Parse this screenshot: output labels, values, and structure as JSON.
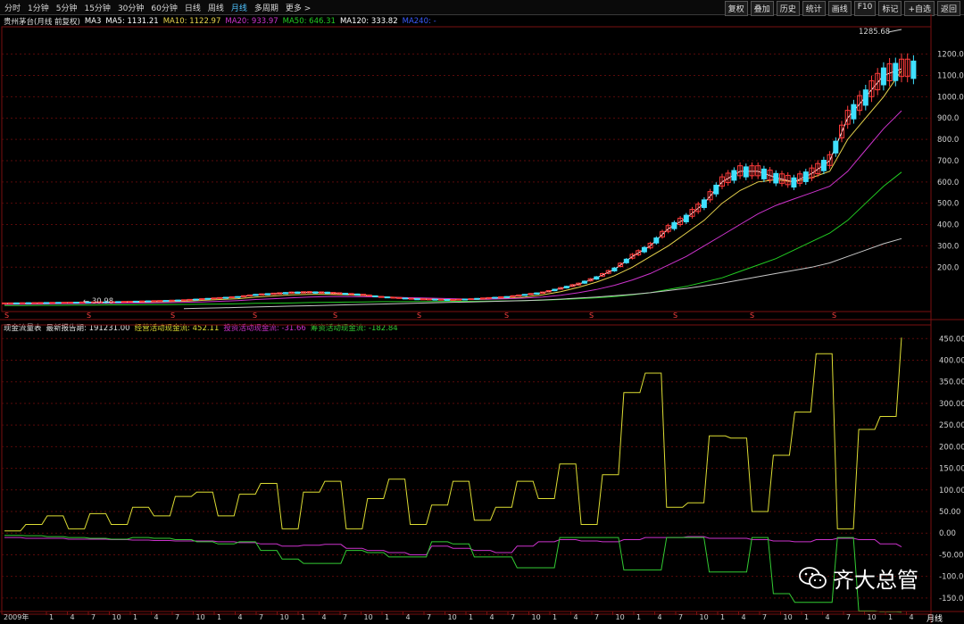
{
  "toolbar": {
    "tabs": [
      "分时",
      "1分钟",
      "5分钟",
      "15分钟",
      "30分钟",
      "60分钟",
      "日线",
      "周线",
      "月线",
      "多周期",
      "更多 >"
    ],
    "active": "月线",
    "right_tools": [
      "复权",
      "叠加",
      "历史",
      "统计",
      "画线",
      "F10",
      "标记",
      "+自选",
      "返回"
    ]
  },
  "price_legend": {
    "title": "贵州茅台(月线 前复权)",
    "ma3": "MA3",
    "ma5": "MA5: 1131.21",
    "ma10": "MA10: 1122.97",
    "ma20": "MA20: 933.97",
    "ma50": "MA50: 646.31",
    "ma120": "MA120: 333.82",
    "ma240": "MA240: -"
  },
  "flow_legend": {
    "title": "现金流量表",
    "report": "最新报告期: 191231.00",
    "op": "经营活动现金流: 452.11",
    "inv": "投资活动现金流: -31.66",
    "fin": "筹资活动现金流: -182.84"
  },
  "annotations": {
    "high": "1285.68",
    "low": "30.98"
  },
  "bottom": {
    "month_label": "月线"
  },
  "watermark": "齐大总管",
  "colors": {
    "up": "#ff3b3b",
    "down": "#40e0ff",
    "ma5": "#ffffff",
    "ma10": "#e8d44d",
    "ma20": "#cc33cc",
    "ma50": "#22cc22",
    "ma120": "#c8c8c8",
    "op": "#dddd33",
    "inv": "#cc33cc",
    "fin": "#33cc33"
  },
  "chart_data": [
    {
      "type": "line",
      "title": "贵州茅台(月线 前复权)",
      "y_ticks": [
        200,
        300,
        400,
        500,
        600,
        700,
        800,
        900,
        1000,
        1100,
        1200
      ],
      "ylim": [
        0,
        1320
      ],
      "series": [
        {
          "name": "MA5",
          "values": [
            30,
            31,
            32,
            33,
            34,
            35,
            36,
            38,
            40,
            42,
            45,
            50,
            55,
            60,
            70,
            75,
            80,
            82,
            80,
            75,
            70,
            60,
            55,
            50,
            48,
            46,
            50,
            55,
            60,
            70,
            80,
            100,
            120,
            150,
            190,
            250,
            300,
            380,
            430,
            500,
            600,
            650,
            650,
            620,
            600,
            640,
            700,
            900,
            1000,
            1100,
            1131.21
          ]
        },
        {
          "name": "MA10",
          "values": [
            28,
            29,
            30,
            31,
            32,
            33,
            34,
            35,
            36,
            38,
            40,
            44,
            48,
            52,
            60,
            65,
            70,
            72,
            72,
            70,
            67,
            62,
            58,
            54,
            50,
            48,
            48,
            50,
            54,
            60,
            70,
            85,
            105,
            130,
            160,
            200,
            250,
            300,
            360,
            420,
            500,
            560,
            600,
            610,
            600,
            620,
            650,
            800,
            900,
            1000,
            1122.97
          ]
        },
        {
          "name": "MA20",
          "values": [
            25,
            26,
            27,
            28,
            29,
            30,
            30,
            31,
            32,
            33,
            35,
            37,
            40,
            43,
            48,
            52,
            56,
            60,
            62,
            62,
            61,
            60,
            58,
            56,
            54,
            52,
            50,
            50,
            52,
            55,
            60,
            68,
            80,
            95,
            115,
            140,
            170,
            210,
            250,
            300,
            350,
            400,
            450,
            490,
            520,
            550,
            580,
            650,
            750,
            850,
            933.97
          ]
        },
        {
          "name": "MA50",
          "values": [
            20,
            20,
            21,
            21,
            22,
            22,
            23,
            23,
            24,
            24,
            25,
            26,
            27,
            28,
            30,
            31,
            32,
            34,
            35,
            36,
            37,
            38,
            38,
            39,
            39,
            40,
            40,
            41,
            42,
            43,
            45,
            48,
            52,
            56,
            62,
            70,
            80,
            95,
            110,
            130,
            150,
            180,
            210,
            240,
            280,
            320,
            360,
            420,
            500,
            580,
            646.31
          ]
        },
        {
          "name": "MA120",
          "values": [
            null,
            null,
            null,
            null,
            null,
            null,
            null,
            null,
            null,
            null,
            5,
            7,
            9,
            11,
            13,
            15,
            17,
            19,
            21,
            23,
            25,
            27,
            29,
            31,
            33,
            35,
            37,
            39,
            41,
            43,
            46,
            50,
            55,
            60,
            66,
            72,
            80,
            90,
            100,
            112,
            125,
            140,
            155,
            170,
            185,
            200,
            220,
            250,
            280,
            310,
            333.82
          ]
        }
      ]
    },
    {
      "type": "line",
      "title": "现金流量表",
      "y_ticks": [
        -150,
        -100,
        -50,
        0,
        50,
        100,
        150,
        200,
        250,
        300,
        350,
        400,
        450
      ],
      "ylim": [
        -175,
        465
      ],
      "series": [
        {
          "name": "经营活动现金流",
          "values": [
            5,
            20,
            40,
            10,
            45,
            20,
            60,
            40,
            85,
            95,
            40,
            90,
            115,
            10,
            95,
            120,
            10,
            80,
            125,
            20,
            65,
            120,
            30,
            60,
            120,
            80,
            160,
            20,
            135,
            325,
            370,
            60,
            70,
            225,
            220,
            50,
            180,
            280,
            415,
            10,
            240,
            270,
            452.11
          ]
        },
        {
          "name": "投资活动现金流",
          "values": [
            -10,
            -12,
            -12,
            -14,
            -14,
            -15,
            -16,
            -17,
            -18,
            -18,
            -20,
            -22,
            -25,
            -30,
            -28,
            -26,
            -35,
            -40,
            -45,
            -50,
            -30,
            -35,
            -40,
            -45,
            -30,
            -20,
            -15,
            -18,
            -20,
            -15,
            -10,
            -10,
            -8,
            -12,
            -12,
            -15,
            -18,
            -20,
            -15,
            -12,
            -15,
            -25,
            -31.66
          ]
        },
        {
          "name": "筹资活动现金流",
          "values": [
            -5,
            -6,
            -8,
            -10,
            -12,
            -14,
            -10,
            -12,
            -15,
            -20,
            -25,
            -20,
            -40,
            -60,
            -70,
            -70,
            -40,
            -45,
            -55,
            -55,
            -20,
            -25,
            -55,
            -55,
            -80,
            -80,
            -10,
            -10,
            -10,
            -85,
            -85,
            -10,
            -10,
            -90,
            -90,
            -10,
            -140,
            -160,
            -160,
            -10,
            -180,
            -182,
            -182.84
          ]
        }
      ]
    }
  ],
  "x_axis": {
    "first_label": "2009年",
    "months": [
      "1",
      "4",
      "7",
      "10"
    ]
  }
}
